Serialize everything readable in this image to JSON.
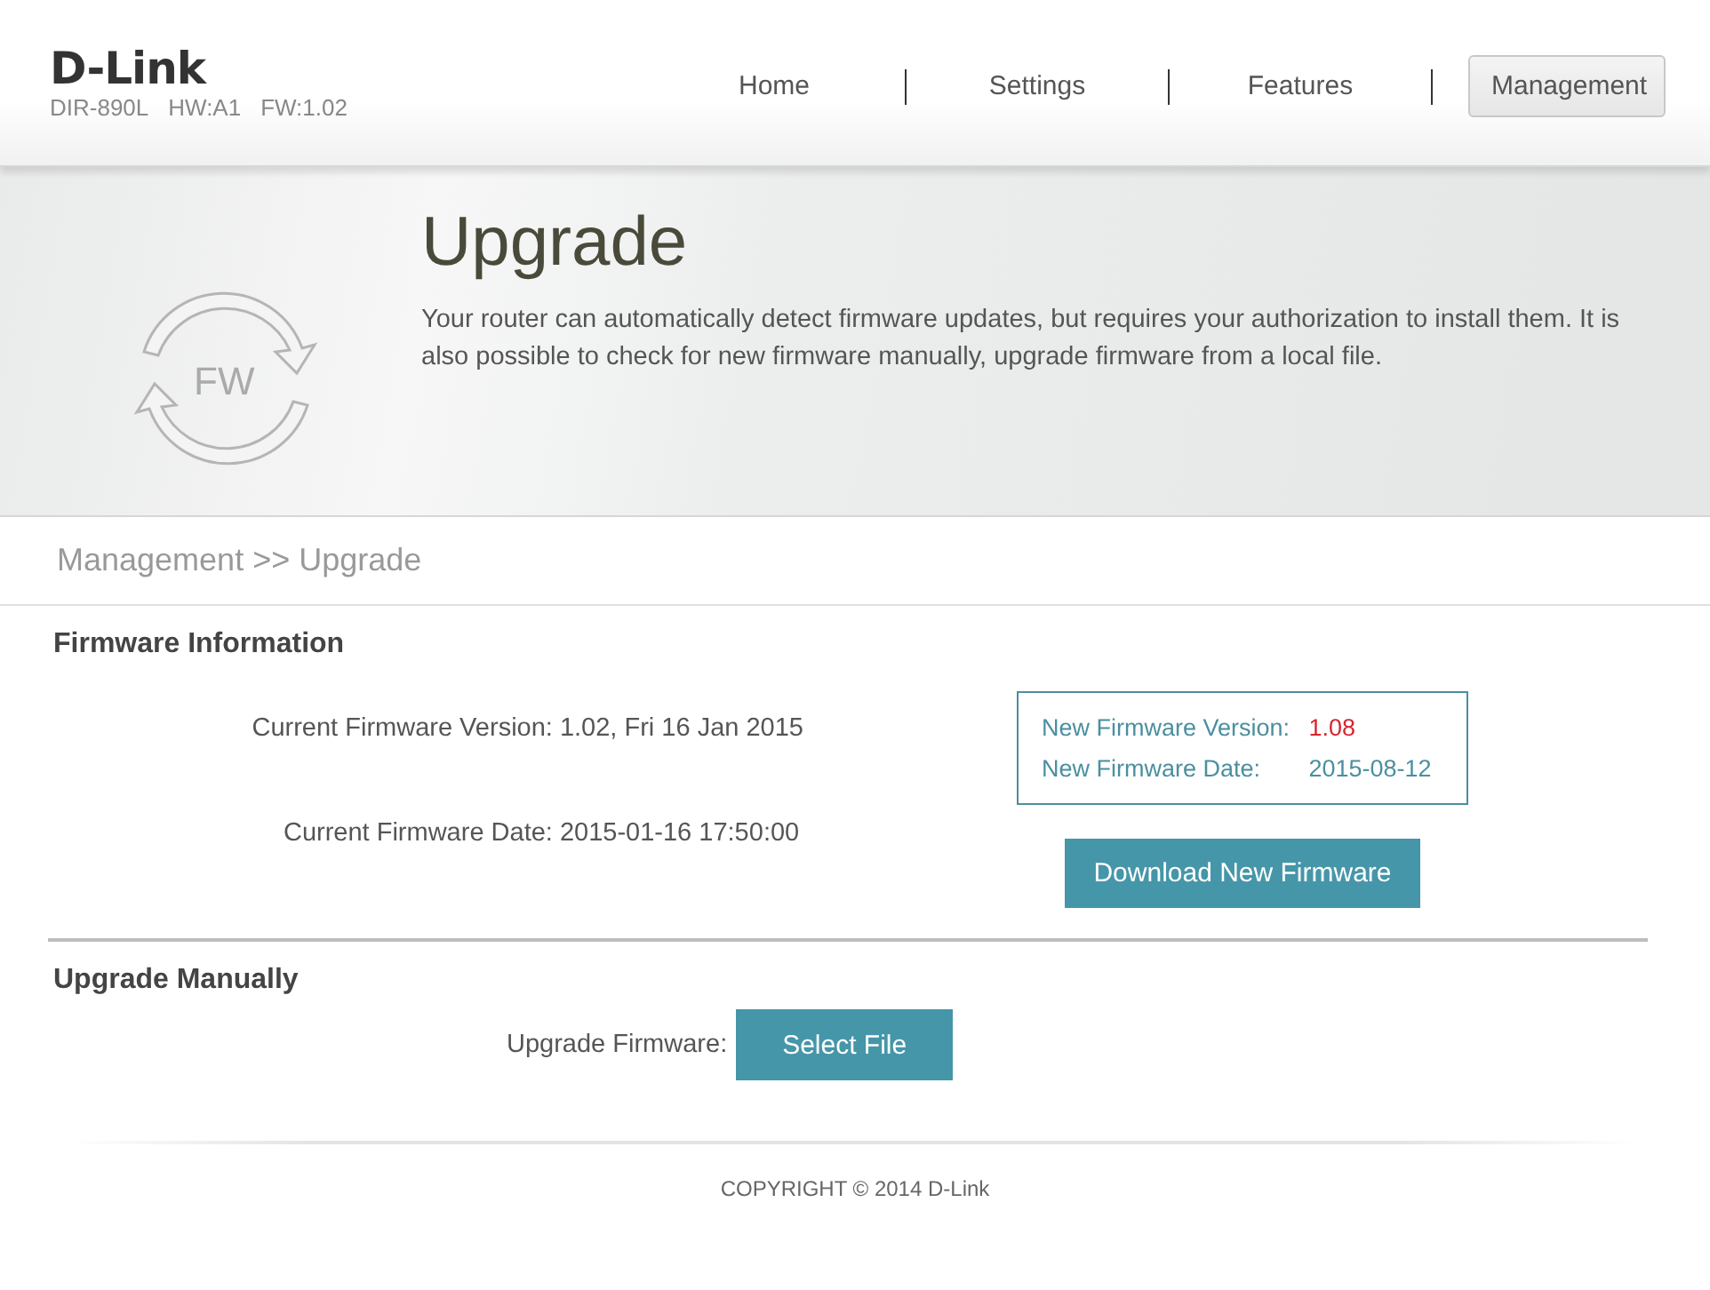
{
  "header": {
    "logo": "D-Link",
    "model_info": [
      "DIR-890L",
      "HW:A1",
      "FW:1.02"
    ],
    "nav": [
      {
        "label": "Home",
        "selected": false
      },
      {
        "label": "Settings",
        "selected": false
      },
      {
        "label": "Features",
        "selected": false
      },
      {
        "label": "Management",
        "selected": true
      }
    ]
  },
  "banner": {
    "icon_label": "FW",
    "title": "Upgrade",
    "description": "Your router can automatically detect firmware updates, but requires your authorization to install them. It is also possible to check for new firmware manually, upgrade firmware from a local file."
  },
  "breadcrumb": "Management >> Upgrade",
  "firmware_information": {
    "heading": "Firmware Information",
    "current": [
      {
        "label": "Current Firmware Version:",
        "value": "1.02, Fri 16 Jan 2015"
      },
      {
        "label": "Current Firmware Date:",
        "value": "2015-01-16 17:50:00"
      }
    ],
    "new": [
      {
        "label": "New Firmware Version:",
        "value": "1.08",
        "color": "#d9232d"
      },
      {
        "label": "New Firmware Date:",
        "value": "2015-08-12",
        "color": "#4b8fa0"
      }
    ],
    "button": "Download New Firmware"
  },
  "upgrade_manually": {
    "heading": "Upgrade Manually",
    "label": "Upgrade Firmware:",
    "button": "Select File"
  },
  "footer": "COPYRIGHT © 2014 D-Link"
}
